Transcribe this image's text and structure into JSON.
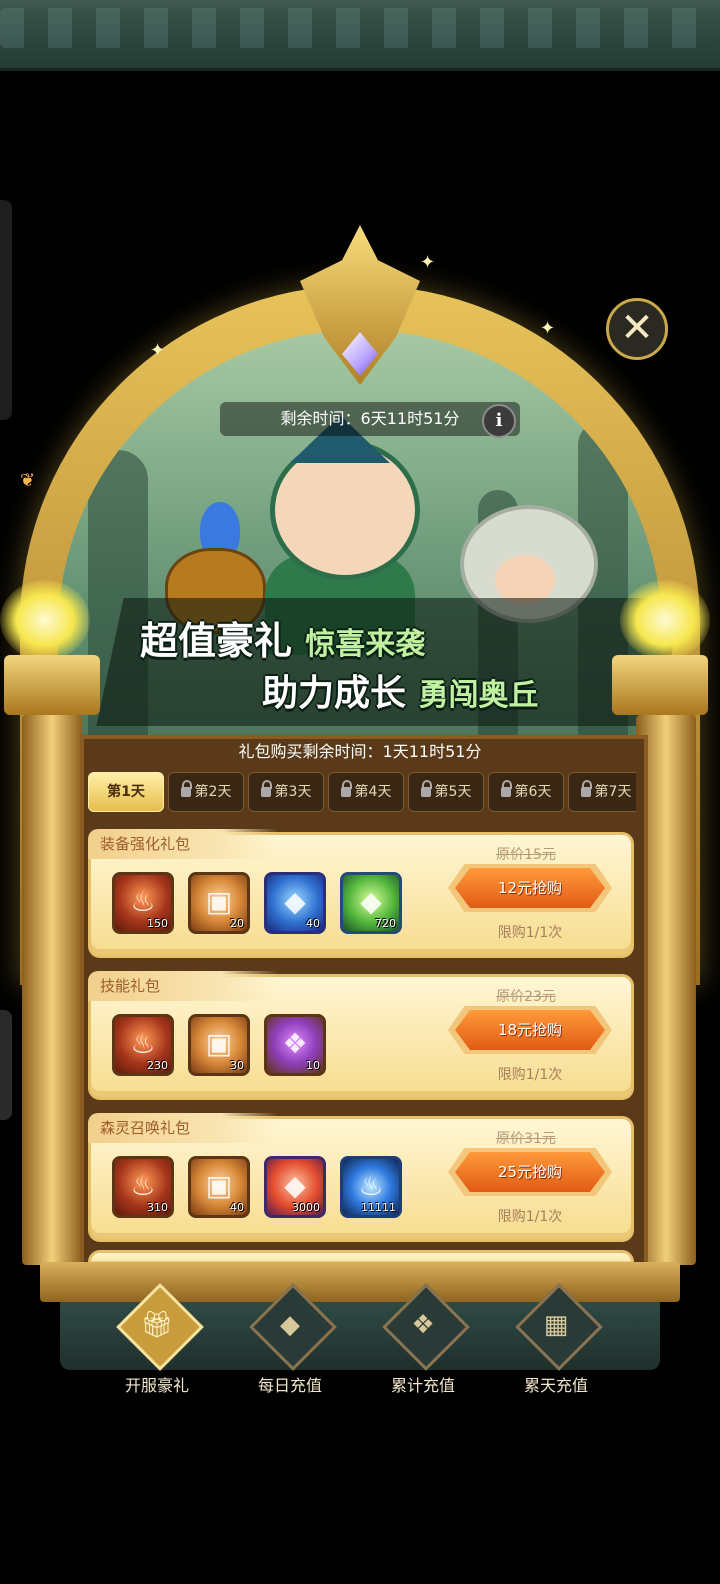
{
  "header": {
    "remaining_time": "剩余时间：6天11时51分",
    "info_icon": "i",
    "close_icon": "✕"
  },
  "banner": {
    "slogan_line1_main": "超值豪礼",
    "slogan_line1_sub": "惊喜来袭",
    "slogan_line2_main": "助力成长",
    "slogan_line2_sub": "勇闯奥丘"
  },
  "panel": {
    "purchase_timer": "礼包购买剩余时间：1天11时51分"
  },
  "tabs": [
    {
      "label": "第1天",
      "locked": false
    },
    {
      "label": "第2天",
      "locked": true
    },
    {
      "label": "第3天",
      "locked": true
    },
    {
      "label": "第4天",
      "locked": true
    },
    {
      "label": "第5天",
      "locked": true
    },
    {
      "label": "第6天",
      "locked": true
    },
    {
      "label": "第7天",
      "locked": true
    }
  ],
  "packs": [
    {
      "title": "装备强化礼包",
      "items": [
        {
          "icon": "red-flame-jar-icon",
          "qty": "150"
        },
        {
          "icon": "golden-lantern-icon",
          "qty": "20"
        },
        {
          "icon": "blue-gem-icon",
          "qty": "40"
        },
        {
          "icon": "green-crystal-icon",
          "qty": "720"
        }
      ],
      "original_price": "原价15元",
      "buy_label": "12元抢购",
      "limit": "限购1/1次"
    },
    {
      "title": "技能礼包",
      "items": [
        {
          "icon": "red-flame-jar-icon",
          "qty": "230"
        },
        {
          "icon": "golden-lantern-icon",
          "qty": "30"
        },
        {
          "icon": "purple-chest-icon",
          "qty": "10"
        }
      ],
      "original_price": "原价23元",
      "buy_label": "18元抢购",
      "limit": "限购1/1次"
    },
    {
      "title": "森灵召唤礼包",
      "items": [
        {
          "icon": "red-flame-jar-icon",
          "qty": "310"
        },
        {
          "icon": "golden-lantern-icon",
          "qty": "40"
        },
        {
          "icon": "red-crystal-icon",
          "qty": "3000"
        },
        {
          "icon": "blue-flame-icon",
          "qty": "11111"
        }
      ],
      "original_price": "原价31元",
      "buy_label": "25元抢购",
      "limit": "限购1/1次"
    }
  ],
  "bottom_nav": [
    {
      "label": "开服豪礼",
      "icon": "gift-icon",
      "active": true
    },
    {
      "label": "每日充值",
      "icon": "diamond-icon",
      "active": false
    },
    {
      "label": "累计充值",
      "icon": "gem-pile-icon",
      "active": false
    },
    {
      "label": "累天充值",
      "icon": "calendar-icon",
      "active": false
    }
  ]
}
